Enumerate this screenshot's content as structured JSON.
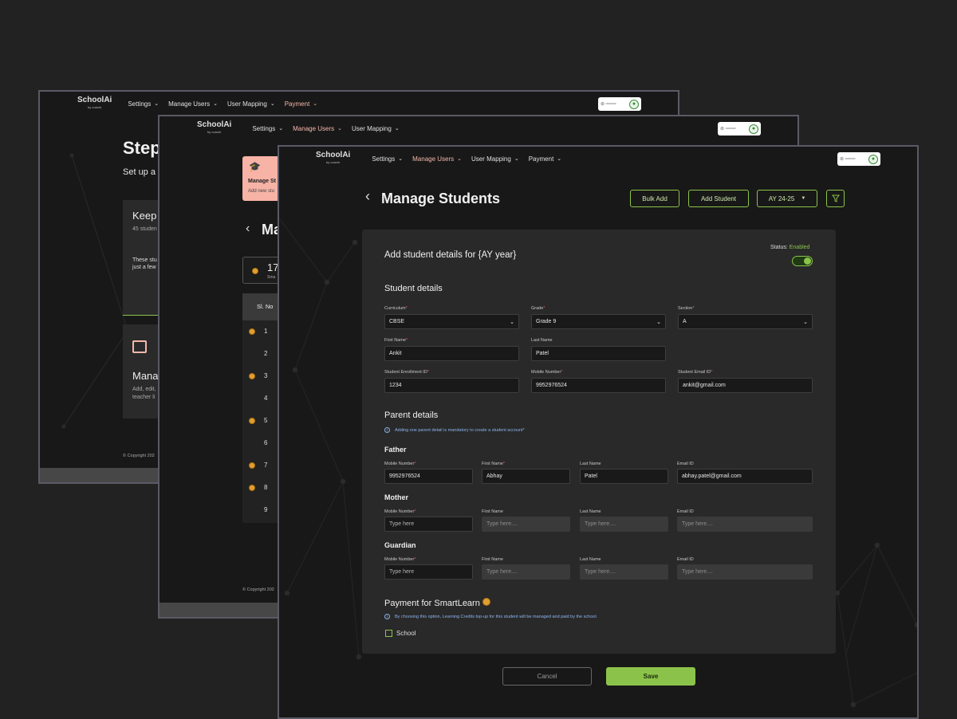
{
  "app": {
    "logo": "SchoolAi",
    "logo_sub": "by coachr"
  },
  "nav": {
    "settings": "Settings",
    "manage_users": "Manage Users",
    "user_mapping": "User Mapping",
    "payment": "Payment"
  },
  "window1": {
    "title": "Step",
    "subtitle": "Set up a",
    "card1_title": "Keep",
    "card1_count": "45 studen",
    "card1_text_1": "These stu",
    "card1_text_2": "just a few",
    "card2_title": "Mana",
    "card2_text_1": "Add, edit,",
    "card2_text_2": "teacher li",
    "copyright": "© Copyright 202"
  },
  "window2": {
    "card_title": "Manage St",
    "card_sub": "Add new stu",
    "heading": "Ma",
    "stat_value": "17",
    "stat_label": "Sma",
    "col_header": "Sl. No",
    "rows": [
      {
        "n": "1",
        "coin": true
      },
      {
        "n": "2",
        "coin": false
      },
      {
        "n": "3",
        "coin": true
      },
      {
        "n": "4",
        "coin": false
      },
      {
        "n": "5",
        "coin": true
      },
      {
        "n": "6",
        "coin": false
      },
      {
        "n": "7",
        "coin": true
      },
      {
        "n": "8",
        "coin": true
      },
      {
        "n": "9",
        "coin": false
      }
    ],
    "copyright": "© Copyright 202"
  },
  "main": {
    "page_title": "Manage Students",
    "bulk_add": "Bulk Add",
    "add_student": "Add Student",
    "year_select": "AY 24-25",
    "form_title": "Add student details for {AY year}",
    "status_label": "Status:",
    "status_value": "Enabled",
    "status_enabled": true,
    "student_section": "Student details",
    "curriculum_label": "Curriculum",
    "curriculum_value": "CBSE",
    "grade_label": "Grade",
    "grade_value": "Grade 9",
    "section_label": "Section",
    "section_value": "A",
    "first_name_label": "First Name",
    "first_name_value": "Ankit",
    "last_name_label": "Last Name",
    "last_name_value": "Patel",
    "enrollment_label": "Student Enrollment ID",
    "enrollment_value": "1234",
    "mobile_label": "Mobile Number",
    "mobile_value": "9952976524",
    "email_label": "Student Email ID",
    "email_value": "ankit@gmail.com",
    "parent_section": "Parent details",
    "parent_info": "Adding one parent detail is mandatory to create a student account*",
    "father": "Father",
    "mother": "Mother",
    "guardian": "Guardian",
    "col_mobile": "Mobile Number",
    "col_first": "First Name",
    "col_last": "Last Name",
    "col_email": "Email ID",
    "father_mobile": "9952976524",
    "father_first": "Abhay",
    "father_last": "Patel",
    "father_email": "abhay.patel@gmail.com",
    "type_here": "Type here",
    "type_here_dots": "Type here....",
    "payment_section": "Payment for SmartLearn",
    "payment_info": "By choosing this option, Learning Credits top-up for this student will be managed and paid by the school.",
    "school_option": "School",
    "cancel": "Cancel",
    "save": "Save"
  },
  "colors": {
    "accent": "#8bc34a",
    "active_nav": "#f5b8ab",
    "required": "#ff5a5a",
    "info": "#8ab4ee",
    "coin": "#e0a030"
  }
}
